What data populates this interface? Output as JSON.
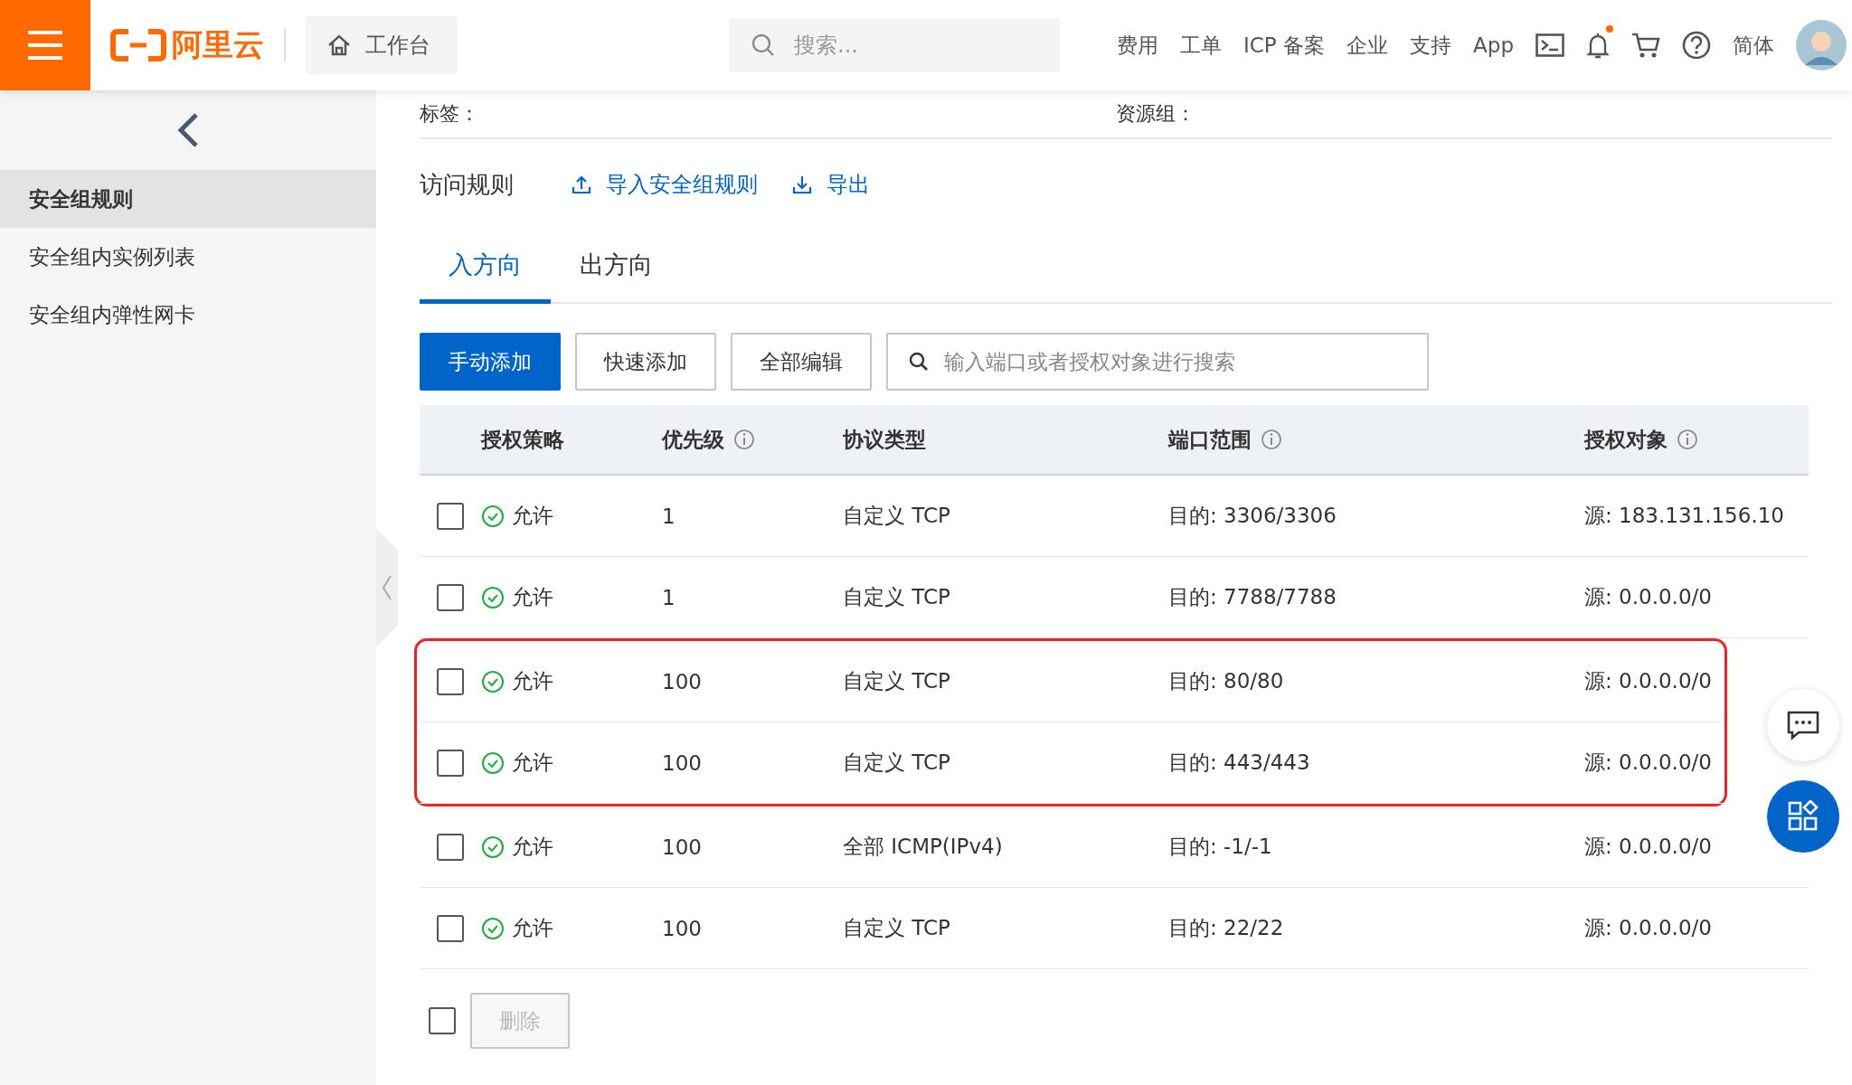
{
  "header": {
    "logo": "阿里云",
    "workbench": "工作台",
    "search": {
      "placeholder": "搜索..."
    },
    "nav": [
      "费用",
      "工单",
      "ICP 备案",
      "企业",
      "支持",
      "App"
    ],
    "notification_dot": true,
    "language": "简体"
  },
  "sidebar": {
    "items": [
      {
        "label": "安全组规则",
        "selected": true
      },
      {
        "label": "安全组内实例列表",
        "selected": false
      },
      {
        "label": "安全组内弹性网卡",
        "selected": false
      }
    ]
  },
  "info": {
    "labels": [
      "标签：",
      "资源组："
    ]
  },
  "section": {
    "title": "访问规则",
    "actions": [
      {
        "label": "导入安全组规则",
        "kind": "upload"
      },
      {
        "label": "导出",
        "kind": "download"
      }
    ]
  },
  "tabs": [
    {
      "label": "入方向",
      "selected": true
    },
    {
      "label": "出方向",
      "selected": false
    }
  ],
  "toolbar": {
    "buttons": [
      {
        "label": "手动添加",
        "primary": true
      },
      {
        "label": "快速添加",
        "primary": false
      },
      {
        "label": "全部编辑",
        "primary": false
      }
    ],
    "search": {
      "placeholder": "输入端口或者授权对象进行搜索"
    }
  },
  "table": {
    "columns": [
      {
        "label": "授权策略",
        "info": false
      },
      {
        "label": "优先级",
        "info": true
      },
      {
        "label": "协议类型",
        "info": false
      },
      {
        "label": "端口范围",
        "info": true
      },
      {
        "label": "授权对象",
        "info": true
      }
    ],
    "rows": [
      {
        "checked": false,
        "highlighted": false,
        "cells": [
          "允许",
          "1",
          "自定义 TCP",
          "目的: 3306/3306",
          "源: 183.131.156.10"
        ]
      },
      {
        "checked": false,
        "highlighted": false,
        "cells": [
          "允许",
          "1",
          "自定义 TCP",
          "目的: 7788/7788",
          "源: 0.0.0.0/0"
        ]
      },
      {
        "checked": false,
        "highlighted": true,
        "cells": [
          "允许",
          "100",
          "自定义 TCP",
          "目的: 80/80",
          "源: 0.0.0.0/0"
        ]
      },
      {
        "checked": false,
        "highlighted": true,
        "cells": [
          "允许",
          "100",
          "自定义 TCP",
          "目的: 443/443",
          "源: 0.0.0.0/0"
        ]
      },
      {
        "checked": false,
        "highlighted": false,
        "cells": [
          "允许",
          "100",
          "全部 ICMP(IPv4)",
          "目的: -1/-1",
          "源: 0.0.0.0/0"
        ]
      },
      {
        "checked": false,
        "highlighted": false,
        "cells": [
          "允许",
          "100",
          "自定义 TCP",
          "目的: 22/22",
          "源: 0.0.0.0/0"
        ]
      }
    ]
  },
  "footer": {
    "select_all_checked": false,
    "delete_button": {
      "label": "删除",
      "disabled": true
    }
  }
}
